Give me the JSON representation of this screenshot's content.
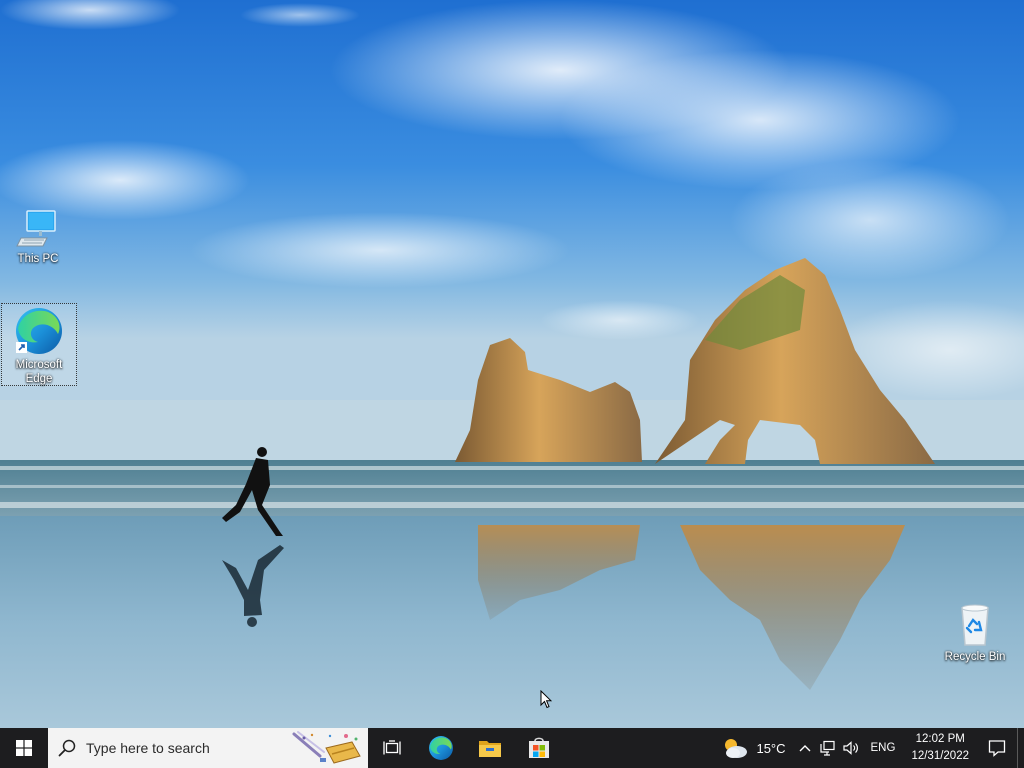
{
  "desktop": {
    "icons": [
      {
        "id": "this-pc",
        "label": "This PC"
      },
      {
        "id": "edge",
        "label": "Microsoft Edge",
        "selected": true
      },
      {
        "id": "recycle-bin",
        "label": "Recycle Bin"
      }
    ]
  },
  "taskbar": {
    "search_placeholder": "Type here to search",
    "pinned_apps": [
      "edge-icon",
      "file-explorer-icon",
      "microsoft-store-icon"
    ],
    "weather": {
      "icon": "partly-cloudy-icon",
      "temperature": "15°C"
    },
    "language": "ENG",
    "time": "12:02 PM",
    "date": "12/31/2022"
  },
  "colors": {
    "taskbar_bg": "#1d1d1f",
    "search_bg": "#f3f3f3",
    "accent": "#0078d7"
  }
}
